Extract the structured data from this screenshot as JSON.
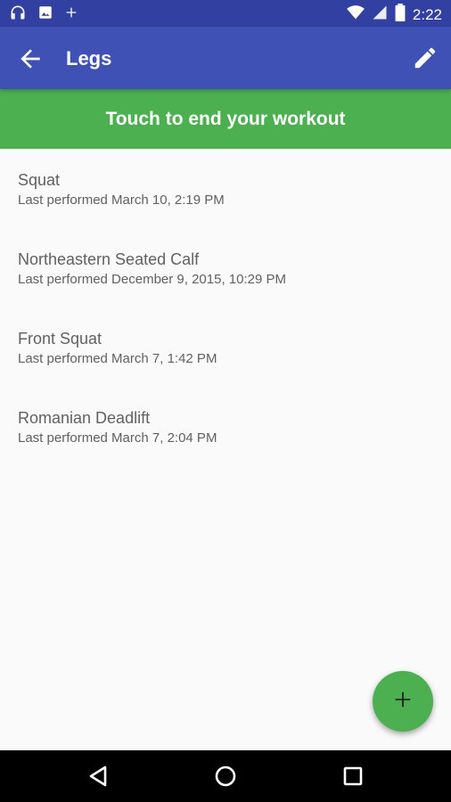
{
  "status_bar": {
    "time": "2:22",
    "left_icons": [
      "headphones-icon",
      "image-icon",
      "plus-icon"
    ],
    "right_icons": [
      "wifi-icon",
      "signal-icon",
      "battery-icon"
    ]
  },
  "app_bar": {
    "title": "Legs",
    "back_icon": "arrow-back-icon",
    "edit_icon": "edit-pencil-icon"
  },
  "banner": {
    "text": "Touch to end your workout"
  },
  "exercises": [
    {
      "name": "Squat",
      "last": "Last performed March 10, 2:19 PM"
    },
    {
      "name": "Northeastern Seated Calf",
      "last": "Last performed December 9, 2015, 10:29 PM"
    },
    {
      "name": "Front Squat",
      "last": "Last performed March 7, 1:42 PM"
    },
    {
      "name": "Romanian Deadlift",
      "last": "Last performed March 7, 2:04 PM"
    }
  ],
  "fab": {
    "icon": "add-icon"
  },
  "nav_bar": {
    "icons": [
      "back-triangle-icon",
      "home-circle-icon",
      "recents-square-icon"
    ]
  },
  "colors": {
    "status_bar": "#3241a1",
    "app_bar": "#3f51b5",
    "banner": "#4caf50",
    "fab": "#4caf50",
    "text": "#616161",
    "background": "#fafafa"
  }
}
